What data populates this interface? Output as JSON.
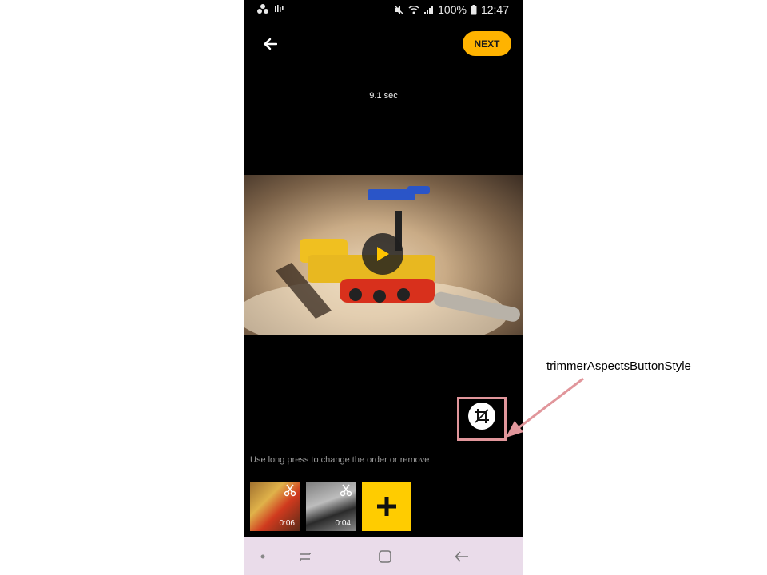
{
  "status_bar": {
    "battery": "100%",
    "time": "12:47",
    "left_icons": [
      "app-dots-icon",
      "voicemail-icon"
    ],
    "right_icons": [
      "mute-icon",
      "wifi-icon",
      "signal-icon",
      "battery-icon"
    ]
  },
  "header": {
    "back_icon": "arrow-left-icon",
    "next_label": "NEXT",
    "next_color": "#ffb300"
  },
  "video": {
    "duration": "9.1 sec",
    "play_icon": "play-icon",
    "play_color": "#ffc400"
  },
  "aspects_button": {
    "icon": "crop-icon"
  },
  "hint": "Use long press to change the order or remove",
  "clips": [
    {
      "duration": "0:06",
      "icon": "scissors-icon"
    },
    {
      "duration": "0:04",
      "icon": "scissors-icon"
    }
  ],
  "add_button": {
    "icon": "plus-icon",
    "color": "#ffcc00"
  },
  "nav_bar": {
    "items": [
      "dot-icon",
      "recents-icon",
      "home-icon",
      "back-icon"
    ]
  },
  "annotation": {
    "label": "trimmerAspectsButtonStyle",
    "color": "#e1969b"
  }
}
